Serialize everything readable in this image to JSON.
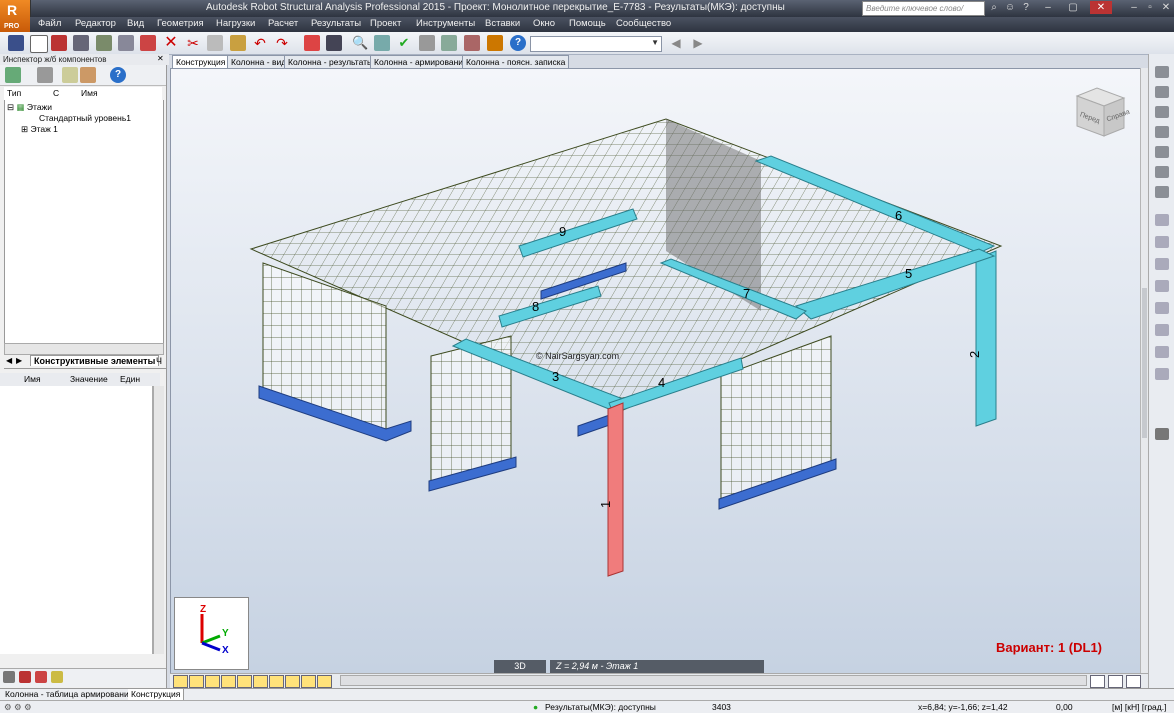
{
  "window": {
    "title": "Autodesk Robot Structural Analysis Professional 2015 - Проект: Монолитное перекрытие_E-7783 - Результаты(МКЭ): доступны",
    "logo_label": "PRO",
    "search_placeholder": "Введите ключевое слово/фразу"
  },
  "menu": [
    "Файл",
    "Редактор",
    "Вид",
    "Геометрия",
    "Нагрузки",
    "Расчет",
    "Результаты",
    "Проект",
    "Инструменты",
    "Вставки",
    "Окно",
    "Помощь",
    "Сообщество"
  ],
  "inspector": {
    "title": "Инспектор ж/б компонентов",
    "columns": {
      "type": "Тип",
      "c": "С",
      "name": "Имя"
    },
    "tree": [
      "Этажи",
      "Стандартный уровень1",
      "Этаж 1"
    ],
    "tab_active": "Конструктивные элементы",
    "tab_other": "Ч"
  },
  "properties": {
    "name": "Имя",
    "value": "Значение",
    "unit": "Един"
  },
  "doc_tabs": [
    "Конструкция",
    "Колонна - вид",
    "Колонна - результаты",
    "Колонна - армирование",
    "Колонна - поясн. записка"
  ],
  "viewport": {
    "variant": "Вариант: 1 (DL1)",
    "view_mode": "3D",
    "level": "Z = 2,94 м - Этаж 1",
    "watermark": "© NairSargsyan.com",
    "member_labels": [
      "1",
      "2",
      "3",
      "4",
      "5",
      "6",
      "7",
      "8",
      "9"
    ],
    "viewcube_faces": [
      "Перед",
      "Справа"
    ],
    "axes": {
      "z": "Z",
      "y": "Y",
      "x": "X"
    }
  },
  "bottom_tabs": [
    "Колонна - таблица армирования",
    "Конструкция"
  ],
  "status": {
    "results": "Результаты(МКЭ): доступны",
    "count": "3403",
    "coords": "x=6,84; y=-1,66; z=1,42",
    "value": "0,00",
    "units": "[м] [кН] [град.]"
  },
  "colors": {
    "slab_mesh": "#3d4a1f",
    "beam": "#5fd0e0",
    "column_selected": "#f07c7c",
    "support": "#3c6dd0",
    "variant": "#cc0000"
  }
}
